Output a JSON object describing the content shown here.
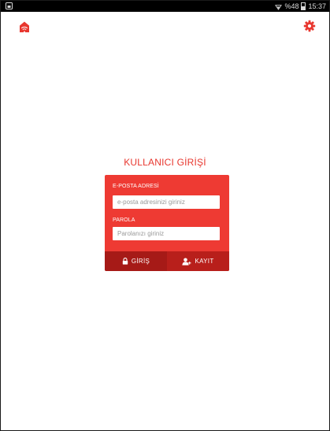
{
  "status_bar": {
    "battery_percent": "%48",
    "time": "15:37",
    "battery_level": 0.48
  },
  "icons": {
    "logo": "home-wifi-icon",
    "settings": "gear-icon",
    "sim": "sim-icon",
    "lock": "lock-icon",
    "add_user": "add-user-icon"
  },
  "colors": {
    "accent": "#e8372f",
    "card": "#ee3a33",
    "button_dark": "#a61a17"
  },
  "login": {
    "title": "KULLANICI GİRİŞİ",
    "email_label": "E-POSTA ADRESİ",
    "email_placeholder": "e-posta adresinizi giriniz",
    "email_value": "",
    "password_label": "PAROLA",
    "password_placeholder": "Parolanızı giriniz",
    "password_value": "",
    "login_button": "GİRİŞ",
    "register_button": "KAYIT"
  }
}
